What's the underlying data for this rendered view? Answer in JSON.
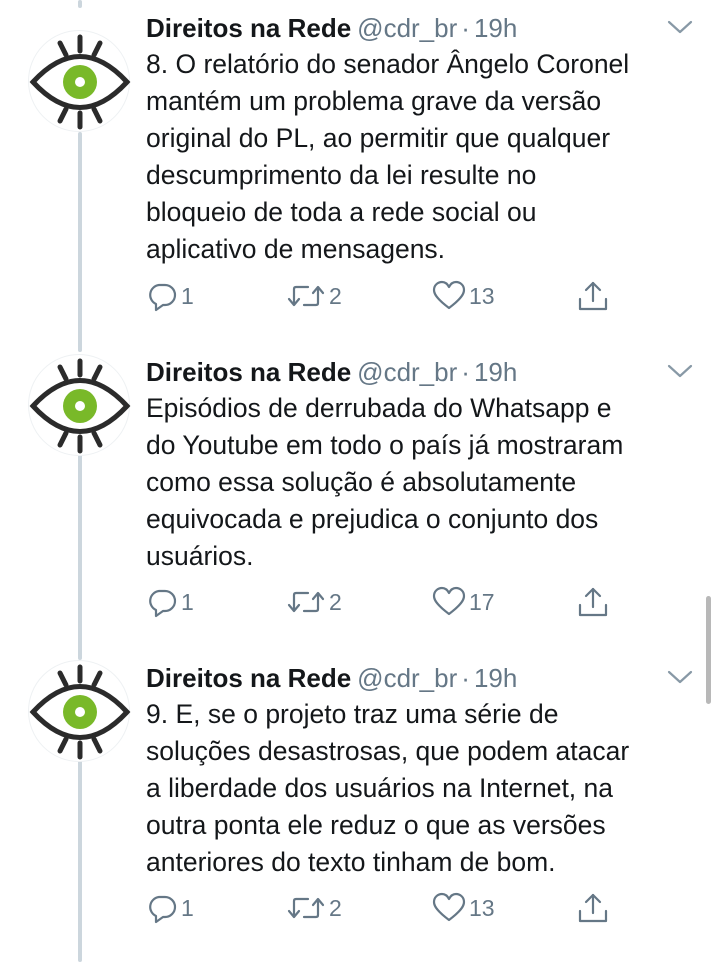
{
  "colors": {
    "text": "#14171a",
    "muted": "#657786",
    "thread_line": "#ccd6dd",
    "eye_green": "#79b929"
  },
  "tweets": [
    {
      "name": "Direitos na Rede",
      "handle": "@cdr_br",
      "sep": "·",
      "time": "19h",
      "lines": [
        "8. O relatório do senador Ângelo Coronel",
        "mantém um problema grave da versão",
        "original do PL, ao permitir que qualquer",
        "descumprimento da lei resulte no",
        "bloqueio de toda a rede social ou",
        "aplicativo de mensagens."
      ],
      "replies": "1",
      "retweets": "2",
      "likes": "13"
    },
    {
      "name": "Direitos na Rede",
      "handle": "@cdr_br",
      "sep": "·",
      "time": "19h",
      "lines": [
        "Episódios de derrubada do Whatsapp e",
        "do Youtube em todo o país já mostraram",
        "como essa solução é absolutamente",
        "equivocada e prejudica o conjunto dos",
        "usuários."
      ],
      "replies": "1",
      "retweets": "2",
      "likes": "17"
    },
    {
      "name": "Direitos na Rede",
      "handle": "@cdr_br",
      "sep": "·",
      "time": "19h",
      "lines": [
        "9. E, se o projeto traz uma série de",
        "soluções desastrosas, que podem atacar",
        "a liberdade dos usuários na Internet, na",
        "outra ponta ele reduz o que as versões",
        "anteriores do texto tinham de bom."
      ],
      "replies": "1",
      "retweets": "2",
      "likes": "13"
    }
  ],
  "icons": {
    "reply": "reply-icon",
    "retweet": "retweet-icon",
    "like": "heart-icon",
    "share": "share-icon",
    "menu": "chevron-down-icon",
    "avatar": "eye-logo-icon"
  }
}
